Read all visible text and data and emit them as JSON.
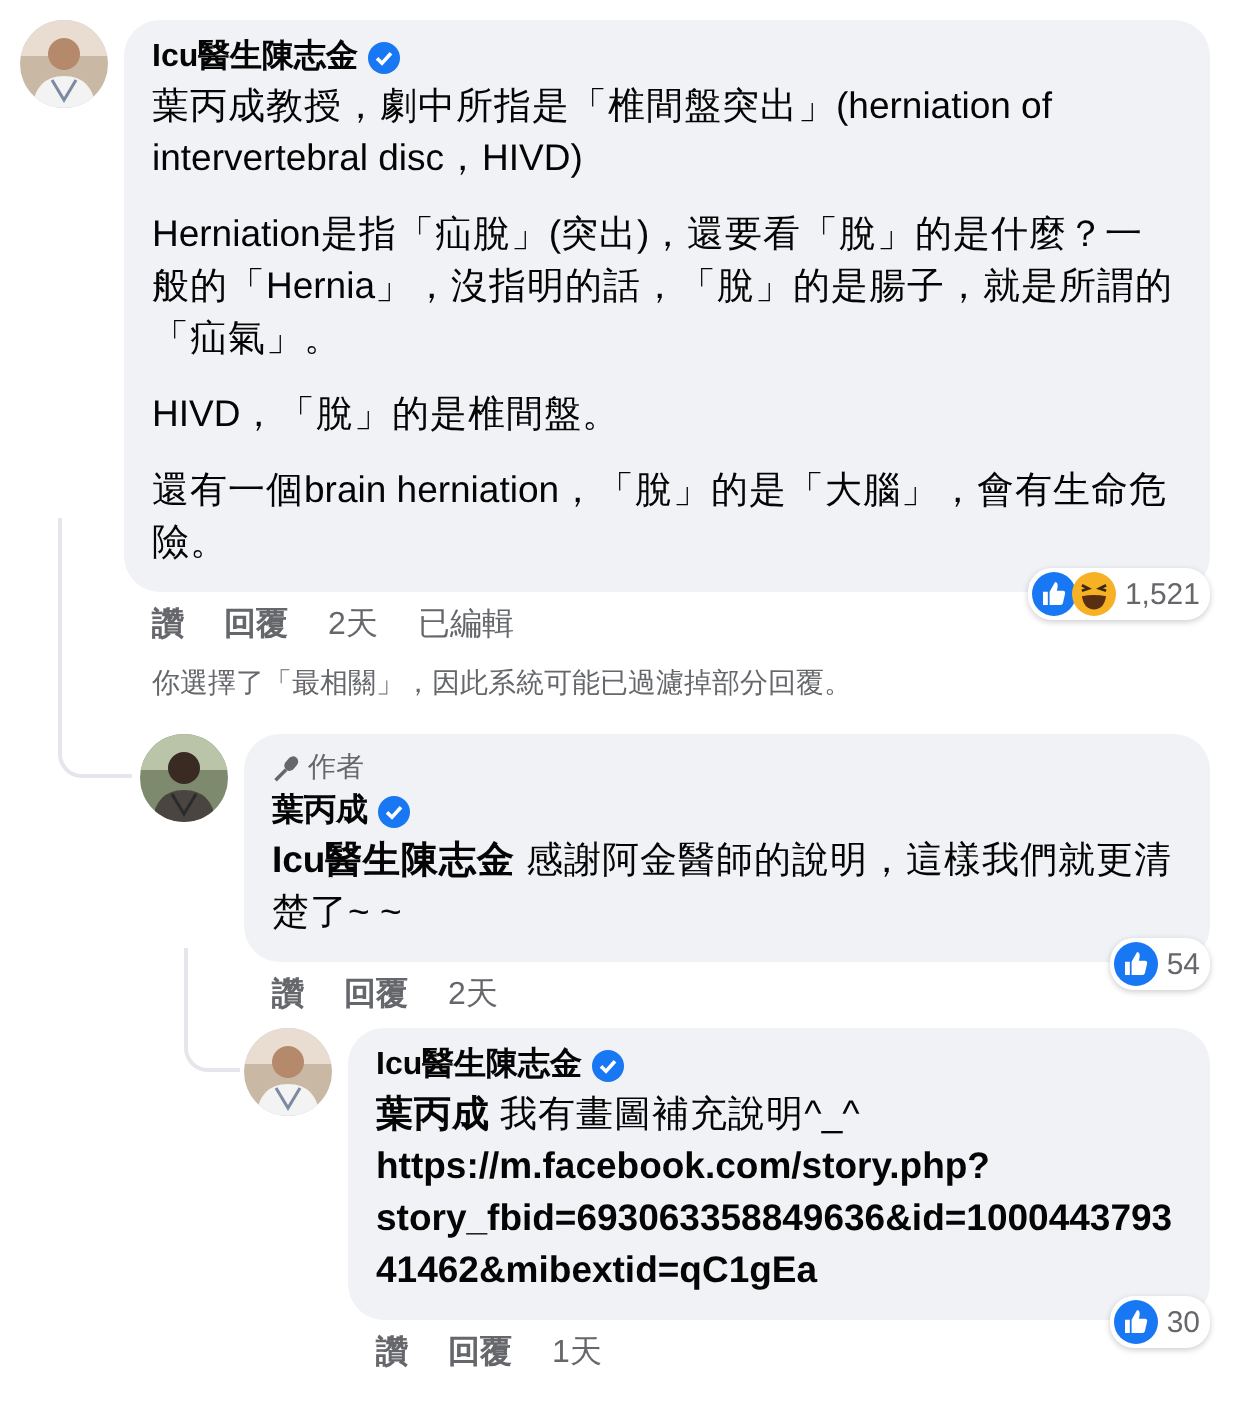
{
  "comments": [
    {
      "author": "Icu醫生陳志金",
      "verified": true,
      "paragraphs": [
        {
          "kind": "text",
          "text": "葉丙成教授，劇中所指是「椎間盤突出」(herniation of intervertebral disc，HIVD)"
        },
        {
          "kind": "text",
          "text": "Herniation是指「疝脫」(突出)，還要看「脫」的是什麼？一般的「Hernia」，沒指明的話，「脫」的是腸子，就是所謂的「疝氣」。"
        },
        {
          "kind": "text",
          "text": "HIVD，「脫」的是椎間盤。"
        },
        {
          "kind": "text",
          "text": "還有一個brain herniation，「脫」的是「大腦」，會有生命危險。"
        }
      ],
      "actions": [
        "讚",
        "回覆"
      ],
      "time": "2天",
      "edited": "已編輯",
      "reactions": [
        {
          "kind": "like"
        },
        {
          "kind": "haha"
        }
      ],
      "reaction_count": "1,521",
      "notice": "你選擇了「最相關」，因此系統可能已過濾掉部分回覆。",
      "replies": [
        {
          "author_badge": "作者",
          "author": "葉丙成",
          "verified": true,
          "paragraphs": [
            {
              "kind": "text",
              "text": "**Icu醫生陳志金** 感謝阿金醫師的說明，這樣我們就更清楚了~ ~"
            }
          ],
          "actions": [
            "讚",
            "回覆"
          ],
          "time": "2天",
          "reactions": [
            {
              "kind": "like"
            }
          ],
          "reaction_count": "54",
          "replies": [
            {
              "author": "Icu醫生陳志金",
              "verified": true,
              "paragraphs": [
                {
                  "kind": "text",
                  "text": "**葉丙成** 我有畫圖補充說明^_^"
                },
                {
                  "kind": "link",
                  "text": "https://m.facebook.com/story.php?story_fbid=693063358849636&id=100044379341462&mibextid=qC1gEa"
                }
              ],
              "actions": [
                "讚",
                "回覆"
              ],
              "time": "1天",
              "reactions": [
                {
                  "kind": "like"
                }
              ],
              "reaction_count": "30"
            }
          ]
        }
      ]
    }
  ]
}
